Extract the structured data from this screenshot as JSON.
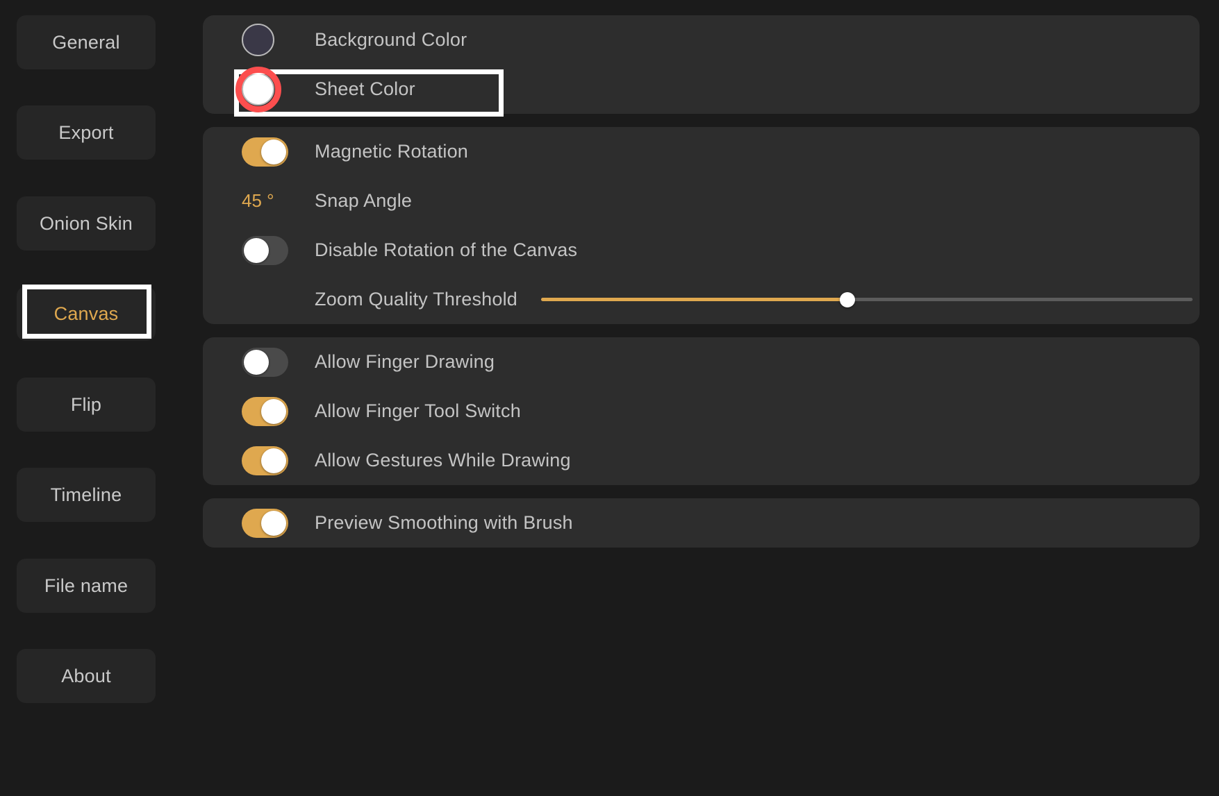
{
  "theme": {
    "page_background": "#1b1b1b",
    "panel_background": "#2d2d2d",
    "accent": "#dfa84f",
    "label_color": "#c4c4c4",
    "annotation_box_color": "#ffffff",
    "annotation_ring_color": "#fc4e4e"
  },
  "sidebar": {
    "items": [
      {
        "label": "General",
        "active": false
      },
      {
        "label": "Export",
        "active": false
      },
      {
        "label": "Onion Skin",
        "active": false
      },
      {
        "label": "Canvas",
        "active": true
      },
      {
        "label": "Flip",
        "active": false
      },
      {
        "label": "Timeline",
        "active": false
      },
      {
        "label": "File name",
        "active": false
      },
      {
        "label": "About",
        "active": false
      }
    ]
  },
  "panels": [
    {
      "name": "colors",
      "rows": [
        {
          "type": "color",
          "label": "Background Color",
          "swatch_color": "#3a3847",
          "icon": "color-swatch-icon",
          "highlighted": false
        },
        {
          "type": "color",
          "label": "Sheet Color",
          "swatch_color": "#ffffff",
          "icon": "color-swatch-icon",
          "highlighted": true
        }
      ]
    },
    {
      "name": "rotation",
      "rows": [
        {
          "type": "toggle",
          "label": "Magnetic Rotation",
          "state": "on"
        },
        {
          "type": "value",
          "label": "Snap Angle",
          "value": "45 °"
        },
        {
          "type": "toggle",
          "label": "Disable Rotation of the Canvas",
          "state": "off"
        },
        {
          "type": "slider",
          "label": "Zoom Quality Threshold",
          "percent": 47
        }
      ]
    },
    {
      "name": "touch",
      "rows": [
        {
          "type": "toggle",
          "label": "Allow Finger Drawing",
          "state": "off"
        },
        {
          "type": "toggle",
          "label": "Allow Finger Tool Switch",
          "state": "on"
        },
        {
          "type": "toggle",
          "label": "Allow Gestures While Drawing",
          "state": "on"
        }
      ]
    },
    {
      "name": "brush",
      "rows": [
        {
          "type": "toggle",
          "label": "Preview Smoothing with Brush",
          "state": "on"
        }
      ]
    }
  ]
}
